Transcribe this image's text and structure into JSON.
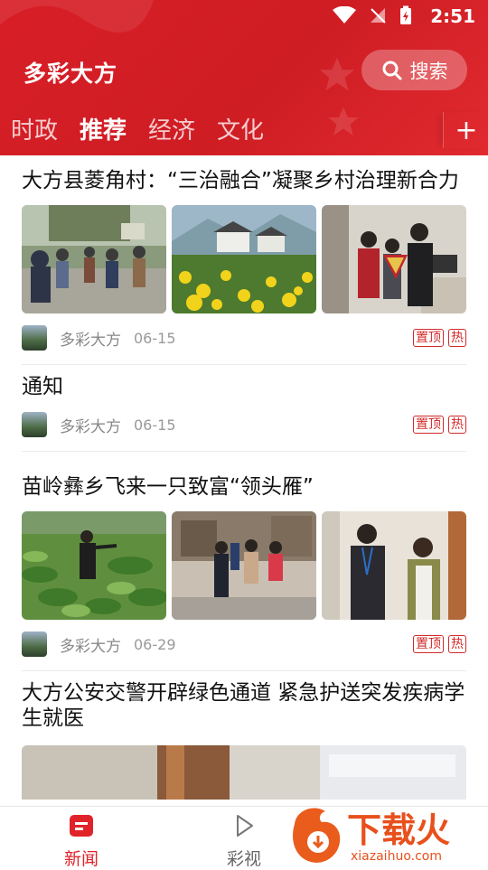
{
  "status_bar": {
    "time": "2:51"
  },
  "header": {
    "app_title": "多彩大方",
    "search_label": "搜索",
    "tabs": [
      "时政",
      "推荐",
      "经济",
      "文化"
    ],
    "active_tab": "推荐",
    "add_label": "+"
  },
  "feed": [
    {
      "title": "大方县菱角村：“三治融合”凝聚乡村治理新合力",
      "source": "多彩大方",
      "date": "06-15",
      "tags": [
        "置顶",
        "热"
      ]
    },
    {
      "title": "通知",
      "source": "多彩大方",
      "date": "06-15",
      "tags": [
        "置顶",
        "热"
      ]
    },
    {
      "title": "苗岭彝乡飞来一只致富“领头雁”",
      "source": "多彩大方",
      "date": "06-29",
      "tags": [
        "置顶",
        "热"
      ]
    },
    {
      "title": "大方公安交警开辟绿色通道 紧急护送突发疾病学生就医"
    }
  ],
  "bottom_nav": [
    {
      "label": "新闻",
      "icon": "news-icon",
      "active": true
    },
    {
      "label": "彩视",
      "icon": "play-icon",
      "active": false
    }
  ],
  "watermark": {
    "text": "下载火",
    "url_text": "xiazaihuo.com"
  },
  "colors": {
    "brand_red": "#d81e26",
    "tag_red": "#d22a2a",
    "nav_active": "#e0232b"
  }
}
